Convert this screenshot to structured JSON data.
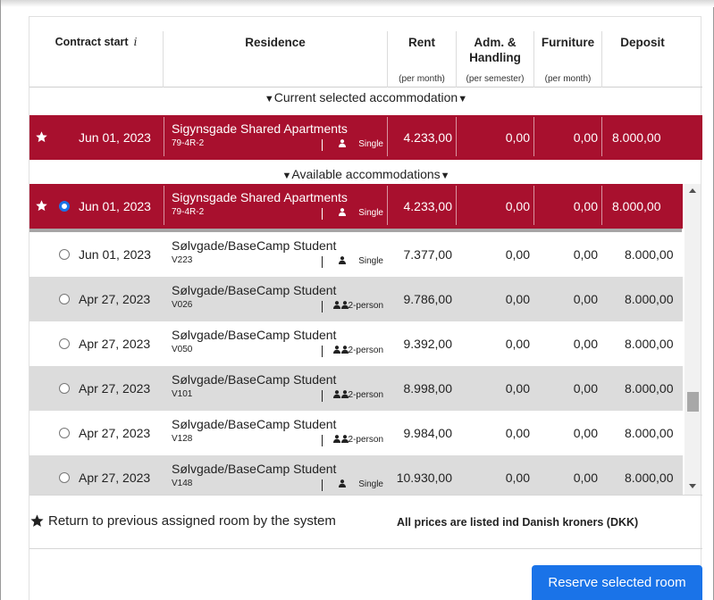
{
  "header": {
    "contract_start": "Contract start",
    "info": "i",
    "residence": "Residence",
    "rent": "Rent",
    "rent_sub": "(per month)",
    "adm_line1": "Adm. &",
    "adm_line2": "Handling",
    "adm_sub": "(per semester)",
    "furniture": "Furniture",
    "furniture_sub": "(per month)",
    "deposit": "Deposit"
  },
  "sections": {
    "current": "Current selected accommodation",
    "available": "Available accommodations"
  },
  "current_row": {
    "date": "Jun 01, 2023",
    "name": "Sigynsgade Shared Apartments",
    "code": "79-4R-2",
    "type": "Single",
    "rent": "4.233,00",
    "adm": "0,00",
    "furniture": "0,00",
    "deposit": "8.000,00"
  },
  "available_rows": [
    {
      "date": "Jun 01, 2023",
      "name": "Sigynsgade Shared Apartments",
      "code": "79-4R-2",
      "type": "Single",
      "rent": "4.233,00",
      "adm": "0,00",
      "furniture": "0,00",
      "deposit": "8.000,00"
    },
    {
      "date": "Jun 01, 2023",
      "name": "Sølvgade/BaseCamp Student",
      "code": "V223",
      "type": "Single",
      "rent": "7.377,00",
      "adm": "0,00",
      "furniture": "0,00",
      "deposit": "8.000,00"
    },
    {
      "date": "Apr 27, 2023",
      "name": "Sølvgade/BaseCamp Student",
      "code": "V026",
      "type": "2-person",
      "rent": "9.786,00",
      "adm": "0,00",
      "furniture": "0,00",
      "deposit": "8.000,00"
    },
    {
      "date": "Apr 27, 2023",
      "name": "Sølvgade/BaseCamp Student",
      "code": "V050",
      "type": "2-person",
      "rent": "9.392,00",
      "adm": "0,00",
      "furniture": "0,00",
      "deposit": "8.000,00"
    },
    {
      "date": "Apr 27, 2023",
      "name": "Sølvgade/BaseCamp Student",
      "code": "V101",
      "type": "2-person",
      "rent": "8.998,00",
      "adm": "0,00",
      "furniture": "0,00",
      "deposit": "8.000,00"
    },
    {
      "date": "Apr 27, 2023",
      "name": "Sølvgade/BaseCamp Student",
      "code": "V128",
      "type": "2-person",
      "rent": "9.984,00",
      "adm": "0,00",
      "furniture": "0,00",
      "deposit": "8.000,00"
    },
    {
      "date": "Apr 27, 2023",
      "name": "Sølvgade/BaseCamp Student",
      "code": "V148",
      "type": "Single",
      "rent": "10.930,00",
      "adm": "0,00",
      "furniture": "0,00",
      "deposit": "8.000,00"
    }
  ],
  "footer": {
    "legend": "Return to previous assigned room by the system",
    "note": "All prices are listed ind Danish kroners (DKK)",
    "reserve_label": "Reserve selected room"
  },
  "colors": {
    "accent_red": "#a8102e",
    "button_blue": "#1a73e8",
    "row_gray": "#dcdcdc"
  }
}
